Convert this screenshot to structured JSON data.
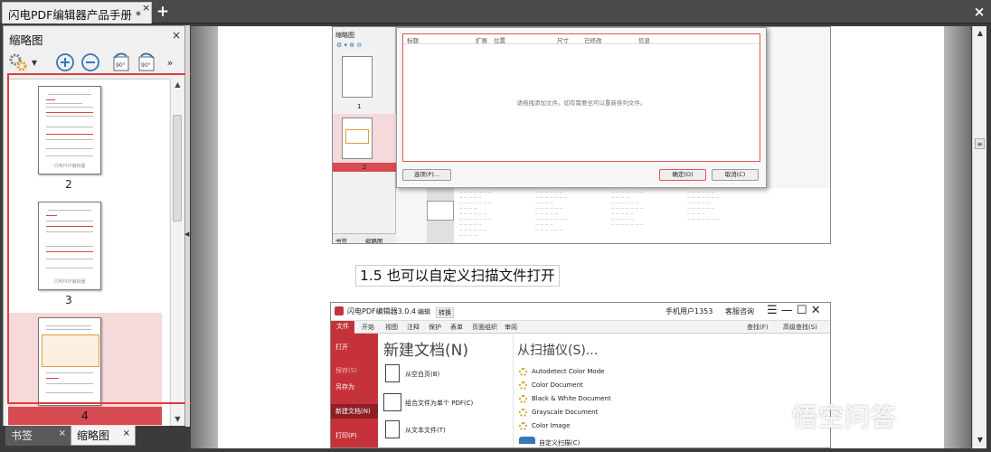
{
  "window": {
    "doc_tab_label": "闪电PDF编辑器产品手册 *",
    "doc_tab_close": "×",
    "new_tab": "+",
    "close": "×"
  },
  "left_panel": {
    "title": "缩略图",
    "close": "×",
    "toolbar": {
      "settings_icon": "gear-icon",
      "zoom_in_icon": "zoom-in-icon",
      "zoom_out_icon": "zoom-out-icon",
      "rotate_left_label": "90°",
      "rotate_right_label": "90°",
      "more_icon": "chevron-down-icon"
    },
    "thumbnails": [
      {
        "page": "2",
        "selected": false,
        "watermark": "闪电PDF编辑器"
      },
      {
        "page": "3",
        "selected": false,
        "watermark": "闪电PDF编辑器"
      },
      {
        "page": "4",
        "selected": true,
        "watermark": ""
      }
    ],
    "bottom_tabs": [
      {
        "label": "书签",
        "active": false
      },
      {
        "label": "缩略图",
        "active": true
      }
    ]
  },
  "document": {
    "shot1": {
      "panel_title": "缩略图",
      "page_numbers": [
        "1",
        "2"
      ],
      "bottom_tabs": [
        "书签",
        "缩略图"
      ],
      "columns": [
        "标题",
        "扩展",
        "位置",
        "尺寸",
        "已修改",
        "信息"
      ],
      "hint": "请拖拽添加文件。如有需要也可以重新排列文件。",
      "options_button": "选项(P)...",
      "ok_button": "确定(O)",
      "cancel_button": "取消(C)"
    },
    "section_heading": "1.5 也可以自定义扫描文件打开",
    "shot2": {
      "app_title": "闪电PDF编辑器3.0.4",
      "title_tabs": [
        "编辑",
        "转换"
      ],
      "user": "手机用户1353",
      "support": "客服咨询",
      "ribbon_tabs": [
        "文件",
        "开始",
        "视图",
        "注释",
        "保护",
        "表单",
        "页面组织",
        "审阅"
      ],
      "find_label": "查找(F)",
      "advanced_find_label": "高级查找(S)",
      "sidebar_items": [
        "打开",
        "保存(S)",
        "另存为",
        "新建文档(N)",
        "打印(P)"
      ],
      "new_doc_title": "新建文档(N)",
      "new_doc_options": [
        "从空白页(B)",
        "组合文件为单个 PDF(C)",
        "从文本文件(T)"
      ],
      "scanner_title": "从扫描仪(S)...",
      "scanner_options": [
        "Autodetect Color Mode",
        "Color Document",
        "Black & White Document",
        "Grayscale Document",
        "Color Image",
        "自定义扫描(C)"
      ]
    }
  },
  "watermark": "悟空问答"
}
